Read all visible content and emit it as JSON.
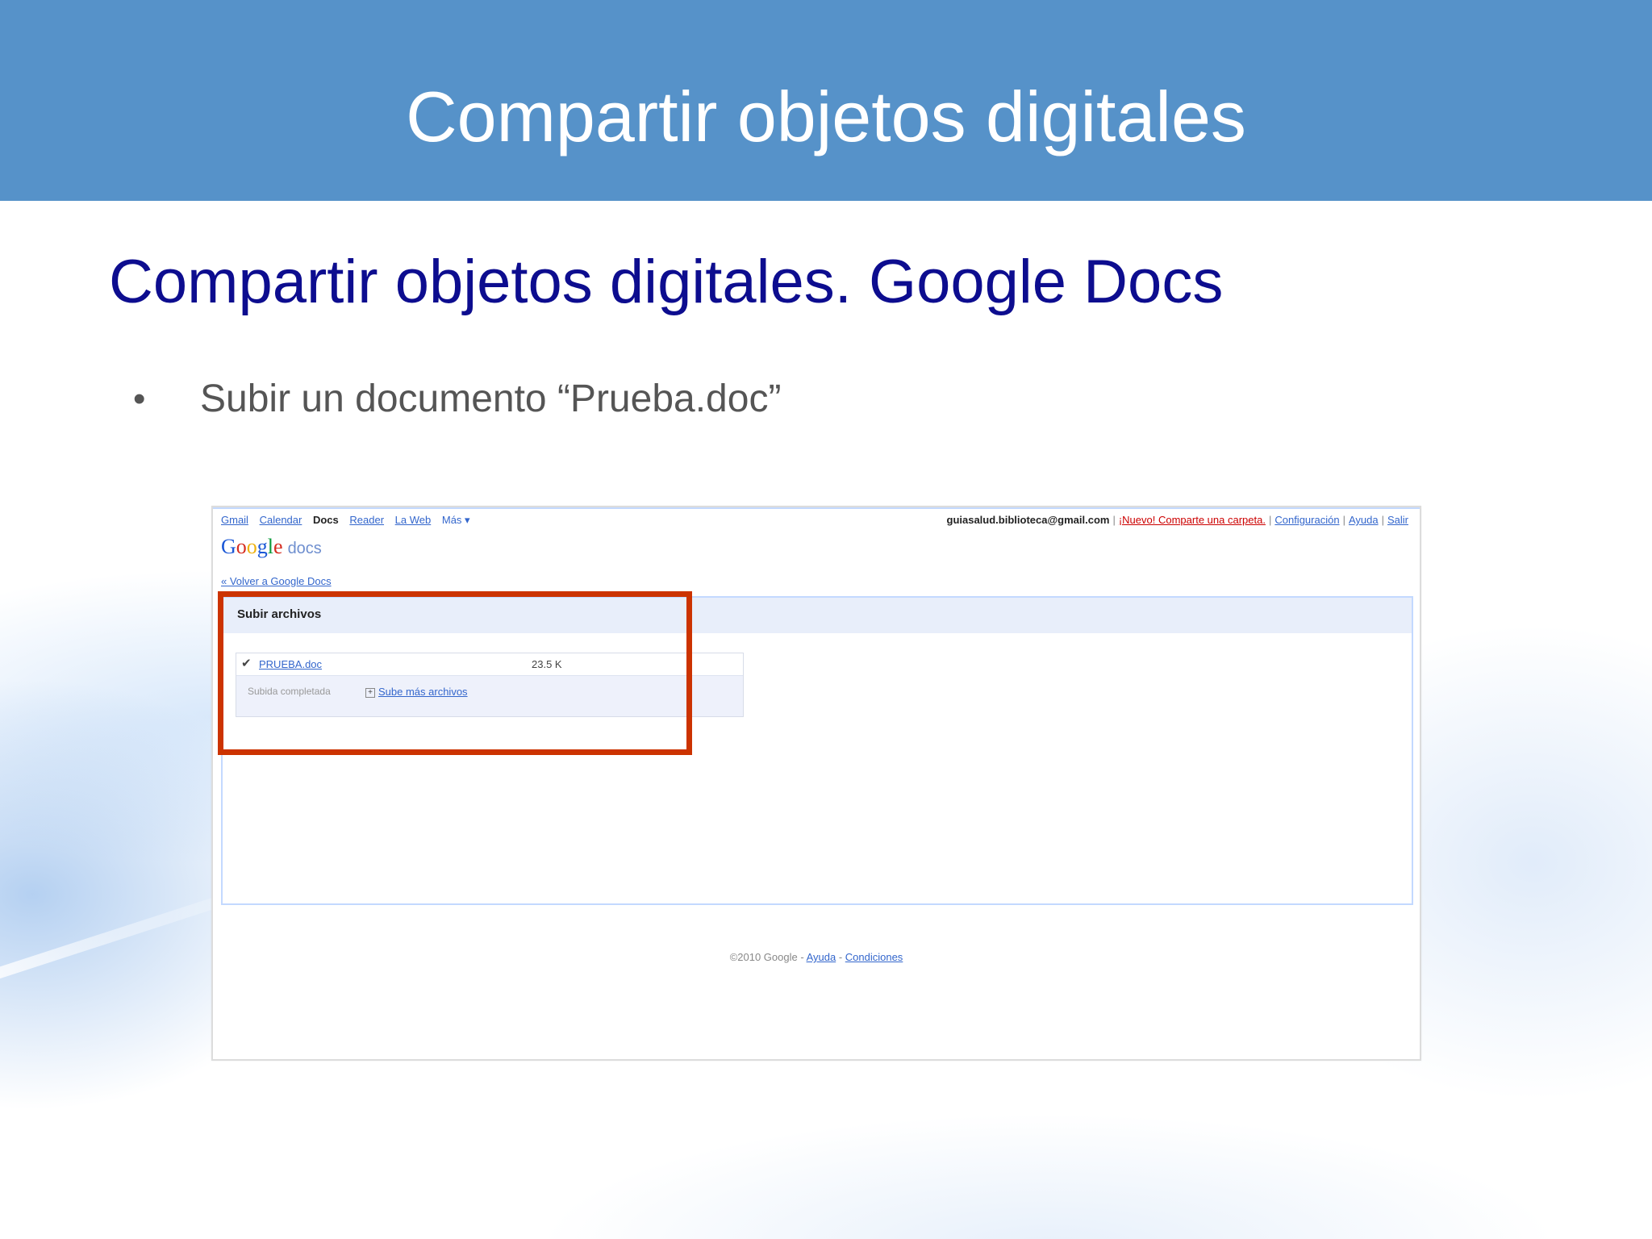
{
  "slide": {
    "header_title": "Compartir objetos digitales",
    "title": "Compartir objetos digitales. Google Docs",
    "bullet": "Subir un documento “Prueba.doc”"
  },
  "screenshot": {
    "nav": [
      "Gmail",
      "Calendar",
      "Docs",
      "Reader",
      "La Web",
      "Más ▾"
    ],
    "account": {
      "email": "guiasalud.biblioteca@gmail.com",
      "new_label": "¡Nuevo! Comparte una carpeta.",
      "settings": "Configuración",
      "help": "Ayuda",
      "signout": "Salir"
    },
    "logo_docs": "docs",
    "back_link": "« Volver a Google Docs",
    "upload": {
      "title": "Subir archivos",
      "file_name": "PRUEBA.doc",
      "file_size": "23.5 K",
      "status": "Subida completada",
      "more": "Sube más archivos"
    },
    "footer": {
      "copyright": "©2010 Google",
      "help": "Ayuda",
      "terms": "Condiciones"
    }
  }
}
